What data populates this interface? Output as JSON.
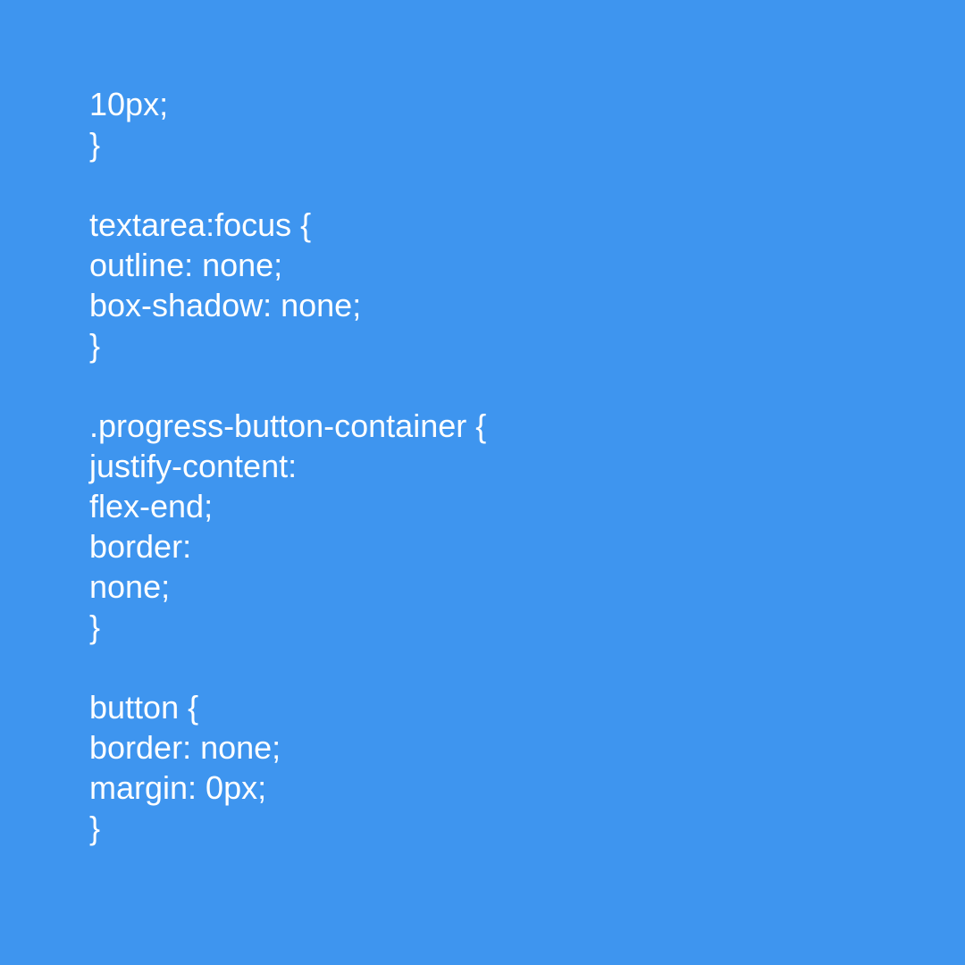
{
  "code": {
    "lines": [
      "10px;",
      "}",
      "",
      "textarea:focus {",
      "outline: none;",
      "box-shadow: none;",
      "}",
      "",
      ".progress-button-container {",
      "justify-content:",
      "flex-end;",
      "border:",
      "none;",
      "}",
      "",
      "button {",
      "border: none;",
      "margin: 0px;",
      "}"
    ]
  },
  "colors": {
    "background": "#3e95ef",
    "text": "#ffffff"
  }
}
